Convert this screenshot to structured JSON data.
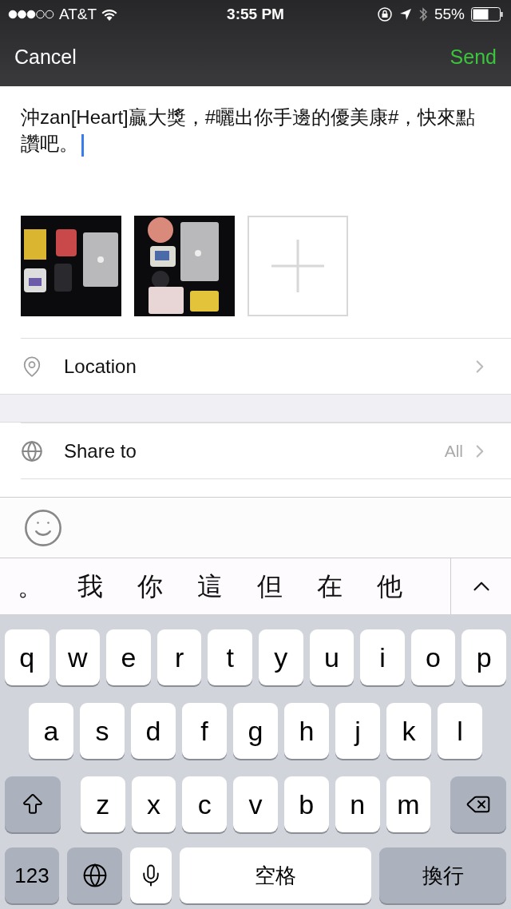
{
  "status_bar": {
    "carrier": "AT&T",
    "time": "3:55 PM",
    "battery": "55%"
  },
  "nav": {
    "cancel": "Cancel",
    "send": "Send"
  },
  "post": {
    "text": "沖zan[Heart]贏大獎，#曬出你手邊的優美康#，快來點讚吧。"
  },
  "photos": [
    {
      "kind": "picture"
    },
    {
      "kind": "picture"
    },
    {
      "kind": "add"
    }
  ],
  "options": [
    {
      "kind": "location",
      "label": "Location"
    },
    {
      "kind": "share",
      "label": "Share to",
      "value": "All"
    }
  ],
  "candidates": [
    "。",
    "我",
    "你",
    "這",
    "但",
    "在",
    "他"
  ],
  "keyboard": {
    "rows": [
      [
        "q",
        "w",
        "e",
        "r",
        "t",
        "y",
        "u",
        "i",
        "o",
        "p"
      ],
      [
        "a",
        "s",
        "d",
        "f",
        "g",
        "h",
        "j",
        "k",
        "l"
      ],
      [
        "z",
        "x",
        "c",
        "v",
        "b",
        "n",
        "m"
      ]
    ],
    "numbers": "123",
    "space": "空格",
    "return": "換行"
  }
}
